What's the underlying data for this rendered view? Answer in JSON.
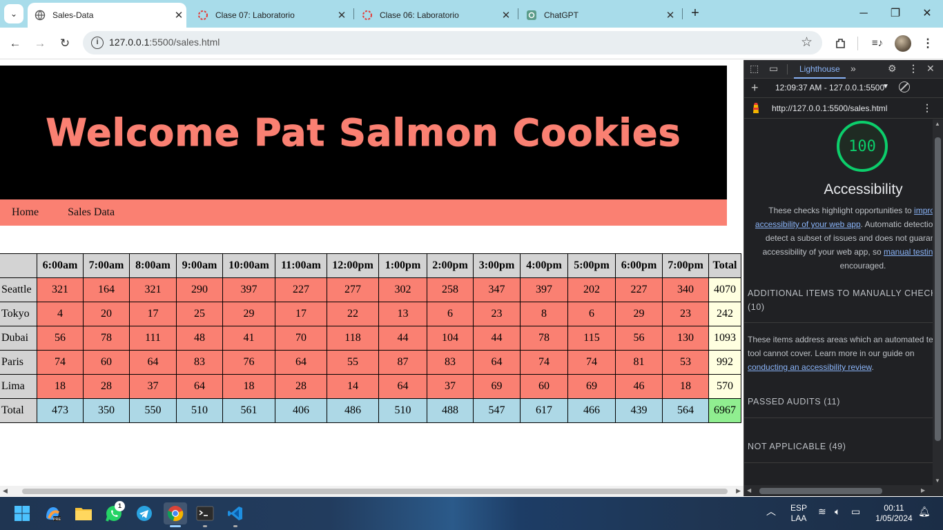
{
  "browser": {
    "tabs": [
      {
        "title": "Sales-Data",
        "active": true
      },
      {
        "title": "Clase 07: Laboratorio",
        "active": false
      },
      {
        "title": "Clase 06: Laboratorio",
        "active": false
      },
      {
        "title": "ChatGPT",
        "active": false
      }
    ],
    "url_host": "127.0.0.1",
    "url_rest": ":5500/sales.html"
  },
  "page": {
    "banner_title": "Welcome Pat Salmon Cookies",
    "nav": [
      "Home",
      "Sales Data"
    ],
    "table": {
      "headers": [
        "",
        "6:00am",
        "7:00am",
        "8:00am",
        "9:00am",
        "10:00am",
        "11:00am",
        "12:00pm",
        "1:00pm",
        "2:00pm",
        "3:00pm",
        "4:00pm",
        "5:00pm",
        "6:00pm",
        "7:00pm",
        "Total"
      ],
      "rows": [
        {
          "city": "Seattle",
          "values": [
            321,
            164,
            321,
            290,
            397,
            227,
            277,
            302,
            258,
            347,
            397,
            202,
            227,
            340
          ],
          "total": 4070
        },
        {
          "city": "Tokyo",
          "values": [
            4,
            20,
            17,
            25,
            29,
            17,
            22,
            13,
            6,
            23,
            8,
            6,
            29,
            23
          ],
          "total": 242
        },
        {
          "city": "Dubai",
          "values": [
            56,
            78,
            111,
            48,
            41,
            70,
            118,
            44,
            104,
            44,
            78,
            115,
            56,
            130
          ],
          "total": 1093
        },
        {
          "city": "Paris",
          "values": [
            74,
            60,
            64,
            83,
            76,
            64,
            55,
            87,
            83,
            64,
            74,
            74,
            81,
            53
          ],
          "total": 992
        },
        {
          "city": "Lima",
          "values": [
            18,
            28,
            37,
            64,
            18,
            28,
            14,
            64,
            37,
            69,
            60,
            69,
            46,
            18
          ],
          "total": 570
        }
      ],
      "totals": {
        "label": "Total",
        "values": [
          473,
          350,
          550,
          510,
          561,
          406,
          486,
          510,
          488,
          547,
          617,
          466,
          439,
          564
        ],
        "grand": 6967
      }
    }
  },
  "devtools": {
    "active_panel": "Lighthouse",
    "report_time": "12:09:37 AM - 127.0.0.1:5500",
    "report_url": "http://127.0.0.1:5500/sales.html",
    "score": "100",
    "category": "Accessibility",
    "desc_1": "These checks highlight opportunities to ",
    "desc_link_1": "improve the accessibility of your web app",
    "desc_2": ". Automatic detection can only detect a subset of issues and does not guarantee the accessibility of your web app, so ",
    "desc_link_2": "manual testing",
    "desc_3": " is also encouraged.",
    "manual_heading": "ADDITIONAL ITEMS TO MANUALLY CHECK",
    "manual_count": "(10)",
    "manual_desc": "These items address areas which an automated testing tool cannot cover. Learn more in our guide on ",
    "manual_link": "conducting an accessibility review",
    "manual_end": ".",
    "passed": "PASSED AUDITS (11)",
    "not_applicable": "NOT APPLICABLE (49)"
  },
  "taskbar": {
    "lang_1": "ESP",
    "lang_2": "LAA",
    "time": "00:11",
    "date": "1/05/2024",
    "whatsapp_badge": "1"
  },
  "colors": {
    "salmon": "#fa8072",
    "light_gray": "#d3d3d3",
    "light_blue": "#add8e6",
    "light_yellow": "#ffffe0",
    "light_green": "#90ee90",
    "lighthouse_green": "#0cce6b",
    "chrome_tab_strip": "#a8dcea"
  }
}
